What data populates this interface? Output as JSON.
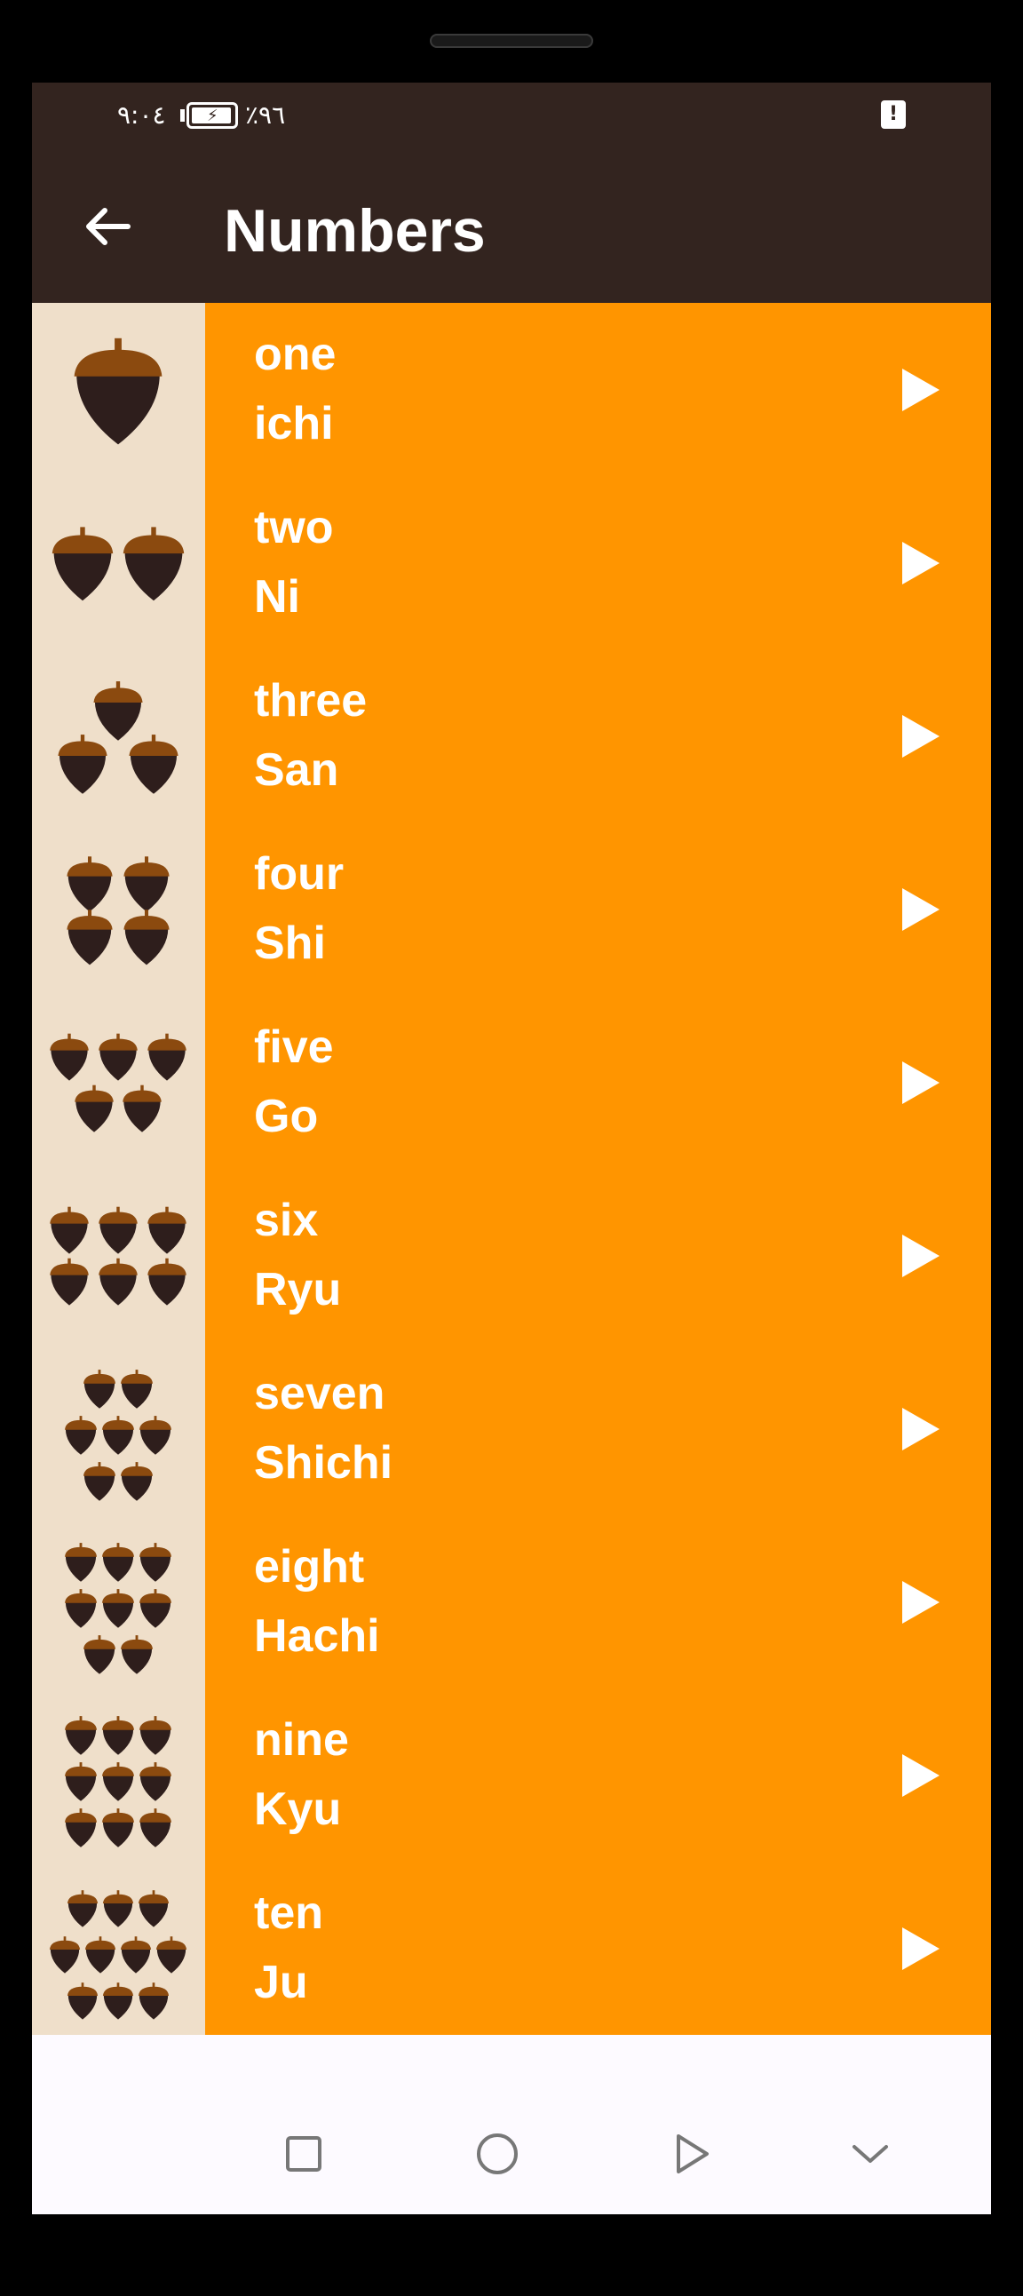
{
  "status_bar": {
    "time": "٩:٠٤",
    "battery_percent": "٪٩٦",
    "battery_level": 0.96,
    "alert_icon": "sim-alert-icon"
  },
  "toolbar": {
    "back_icon": "arrow-left-icon",
    "title": "Numbers"
  },
  "colors": {
    "toolbar_bg": "#33241f",
    "row_bg": "#ff9500",
    "thumb_bg": "#efdfca",
    "acorn_cap": "#8b4a0f",
    "acorn_body": "#2e1e1c"
  },
  "items": [
    {
      "english": "one",
      "japanese": "ichi",
      "count": 1
    },
    {
      "english": "two",
      "japanese": "Ni",
      "count": 2
    },
    {
      "english": "three",
      "japanese": "San",
      "count": 3
    },
    {
      "english": "four",
      "japanese": "Shi",
      "count": 4
    },
    {
      "english": "five",
      "japanese": "Go",
      "count": 5
    },
    {
      "english": "six",
      "japanese": "Ryu",
      "count": 6
    },
    {
      "english": "seven",
      "japanese": "Shichi",
      "count": 7
    },
    {
      "english": "eight",
      "japanese": "Hachi",
      "count": 8
    },
    {
      "english": "nine",
      "japanese": "Kyu",
      "count": 9
    },
    {
      "english": "ten",
      "japanese": "Ju",
      "count": 10
    }
  ],
  "nav_bar": {
    "icons": [
      "square-recents-icon",
      "circle-home-icon",
      "triangle-back-icon",
      "chevron-down-icon"
    ]
  }
}
